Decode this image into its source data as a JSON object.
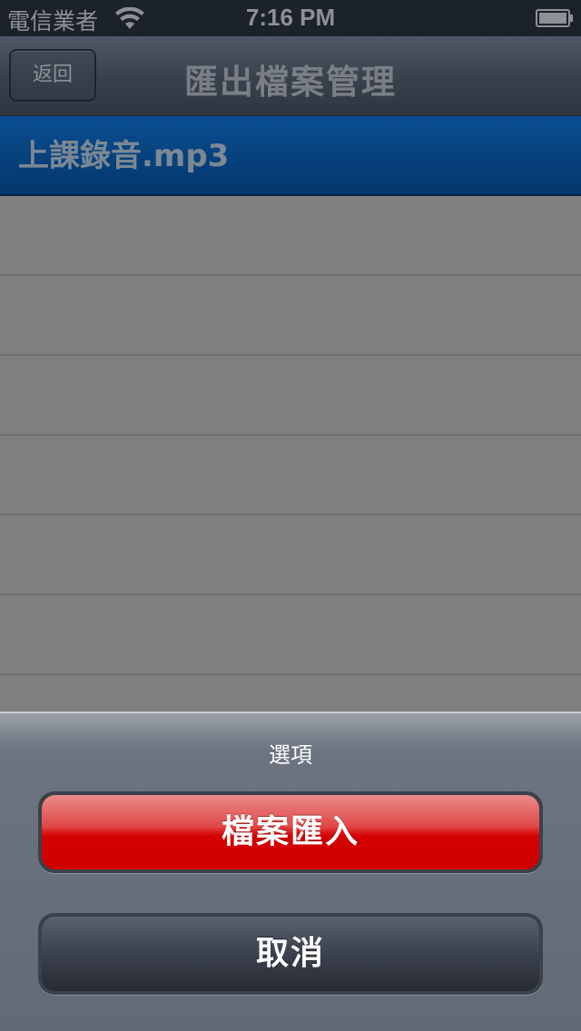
{
  "status_bar": {
    "carrier": "電信業者",
    "time": "7:16 PM",
    "wifi_icon": "wifi-icon",
    "battery_icon": "battery-icon"
  },
  "nav_bar": {
    "back_label": "返回",
    "title": "匯出檔案管理"
  },
  "file_list": {
    "items": [
      {
        "label": "上課錄音.mp3",
        "selected": true
      }
    ]
  },
  "action_sheet": {
    "title": "選項",
    "import_label": "檔案匯入",
    "cancel_label": "取消"
  },
  "colors": {
    "selected_row": "#04366b",
    "destructive": "#d40000",
    "dim_overlay": "#7f7f7f"
  }
}
